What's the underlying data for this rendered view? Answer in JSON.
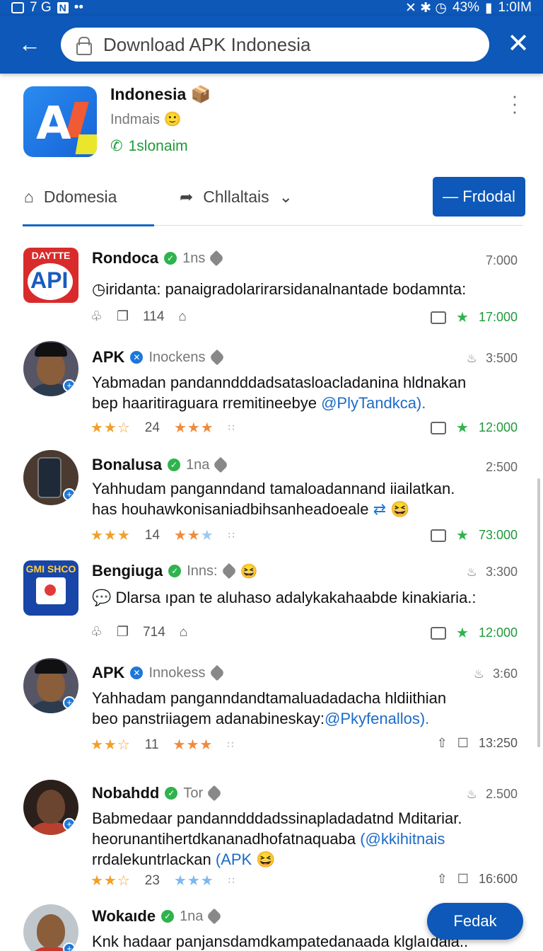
{
  "status_bar": {
    "left_text": "7 G",
    "left_badge": "N",
    "left_dots": "••",
    "right_icons": "✕ ✱ ◷",
    "battery": "43%",
    "time": "1:0IM"
  },
  "search": {
    "value": "Download APK Indonesia"
  },
  "app": {
    "title": "Indonesia",
    "subtitle": "Indmais",
    "call_label": "1slonaim",
    "subtitle_emoji": "🙂",
    "title_emoji": "📦"
  },
  "tabs": [
    {
      "label": "Ddomesia"
    },
    {
      "label": "Chllaltais"
    }
  ],
  "primary_button": {
    "label": "— Frdodal"
  },
  "fab": {
    "label": "Fedak"
  },
  "posts": [
    {
      "name": "Rondoca",
      "handle": "1ns",
      "time": "7:000",
      "body_lines": [
        "◷iridanta: panaigradolarirarsidanalnantade bodamnta:"
      ],
      "count": "114",
      "right_value": "17:000",
      "emblem_top": "DAYTTE",
      "emblem_main": "API"
    },
    {
      "name": "APK",
      "handle": "Inockens",
      "time": "3:500",
      "body_lines": [
        "Yabmadan pandanndddadsatasloacladanina hldnakan",
        "bep haaritiraguara rremitineebye"
      ],
      "mention": "@PlyTandkca).",
      "count": "24",
      "right_value": "12:000"
    },
    {
      "name": "Bonalusa",
      "handle": "1na",
      "time": "2:500",
      "body_lines": [
        "Yahhudam panganndand tamaloadannand iiailatkan.",
        "has houhawkonisaniadbihsanheadoeale"
      ],
      "count": "14",
      "right_value": "73:000"
    },
    {
      "name": "Bengiuga",
      "handle": "Inns:",
      "time": "3:300",
      "body_lines": [
        "Dlarsa ıpan te aluhaso adalykakahaabde kinakiaria.:"
      ],
      "body_prefix": "Dlarsa",
      "count": "714",
      "right_value": "12:000",
      "emblem_top": "GMI SHCO"
    },
    {
      "name": "APK",
      "handle": "Innokess",
      "time": "3:60",
      "body_lines": [
        "Yahhadam panganndandtamaluadadacha hldiithian",
        "beo panstriiagem adanabineskay:"
      ],
      "mention": "@Pkyfenallos).",
      "count": "11",
      "right_value": "13:250"
    },
    {
      "name": "Nobahdd",
      "handle": "Tor",
      "time": "2.500",
      "body_lines": [
        "Babmedaar pandanndddadssinapladadatnd Mditariar.",
        "heorunantihertdkananadhofatnaquaba",
        "rrdalekuntrlackan"
      ],
      "mention": "(@kkihitnais",
      "mention2": "(APK",
      "count": "23",
      "right_value": "16:600"
    },
    {
      "name": "Wokaıde",
      "handle": "1na",
      "time": "",
      "body_lines": [
        "Knk hadaar panjansdamdkampatedanaada klglaıdaia.."
      ]
    }
  ]
}
